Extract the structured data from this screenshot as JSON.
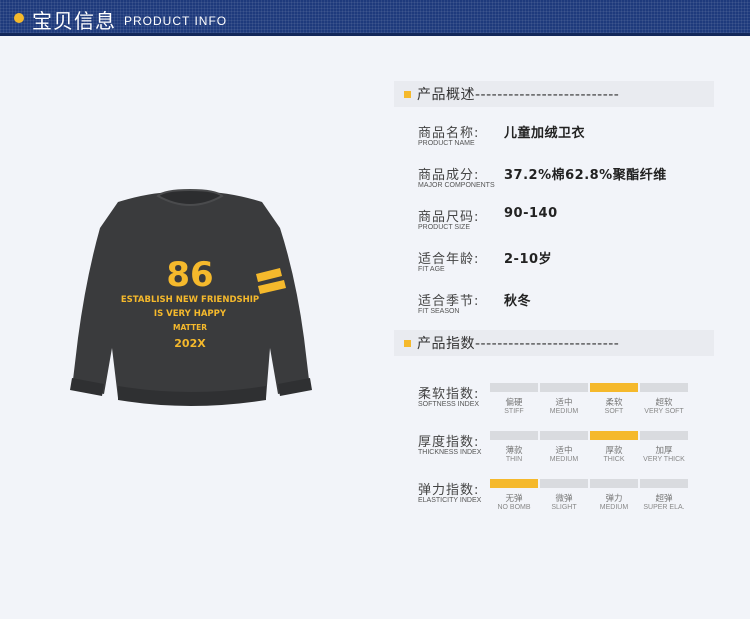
{
  "header": {
    "title_cn": "宝贝信息",
    "title_en": "PRODUCT INFO"
  },
  "product_image": {
    "number": "86",
    "line1": "ESTABLISH NEW FRIENDSHIP",
    "line2": "IS VERY HAPPY",
    "line3": "MATTER",
    "line4": "202X"
  },
  "overview": {
    "heading": "产品概述--------------------------",
    "rows": [
      {
        "label_cn": "商品名称:",
        "label_en": "PRODUCT NAME",
        "value": "儿童加绒卫衣"
      },
      {
        "label_cn": "商品成分:",
        "label_en": "MAJOR COMPONENTS",
        "value": "37.2%棉62.8%聚酯纤维"
      },
      {
        "label_cn": "商品尺码:",
        "label_en": "PRODUCT SIZE",
        "value": "90-140"
      },
      {
        "label_cn": "适合年龄:",
        "label_en": "FIT AGE",
        "value": "2-10岁"
      },
      {
        "label_cn": "适合季节:",
        "label_en": "FIT SEASON",
        "value": "秋冬"
      }
    ]
  },
  "indices": {
    "heading": "产品指数--------------------------",
    "rows": [
      {
        "label_cn": "柔软指数:",
        "label_en": "SOFTNESS INDEX",
        "selected": 2,
        "levels": [
          {
            "cn": "偏硬",
            "en": "STIFF"
          },
          {
            "cn": "适中",
            "en": "MEDIUM"
          },
          {
            "cn": "柔软",
            "en": "SOFT"
          },
          {
            "cn": "超软",
            "en": "VERY SOFT"
          }
        ]
      },
      {
        "label_cn": "厚度指数:",
        "label_en": "THICKNESS INDEX",
        "selected": 2,
        "levels": [
          {
            "cn": "薄款",
            "en": "THIN"
          },
          {
            "cn": "适中",
            "en": "MEDIUM"
          },
          {
            "cn": "厚款",
            "en": "THICK"
          },
          {
            "cn": "加厚",
            "en": "VERY THICK"
          }
        ]
      },
      {
        "label_cn": "弹力指数:",
        "label_en": "ELASTICITY INDEX",
        "selected": 0,
        "levels": [
          {
            "cn": "无弹",
            "en": "NO BOMB"
          },
          {
            "cn": "微弹",
            "en": "SLIGHT"
          },
          {
            "cn": "弹力",
            "en": "MEDIUM"
          },
          {
            "cn": "超弹",
            "en": "SUPER ELA."
          }
        ]
      }
    ]
  },
  "colors": {
    "header_bg": "#1e3a7c",
    "accent": "#f5b92c",
    "bar_off": "#d9dbdf",
    "sweatshirt": "#3a3b3d"
  }
}
